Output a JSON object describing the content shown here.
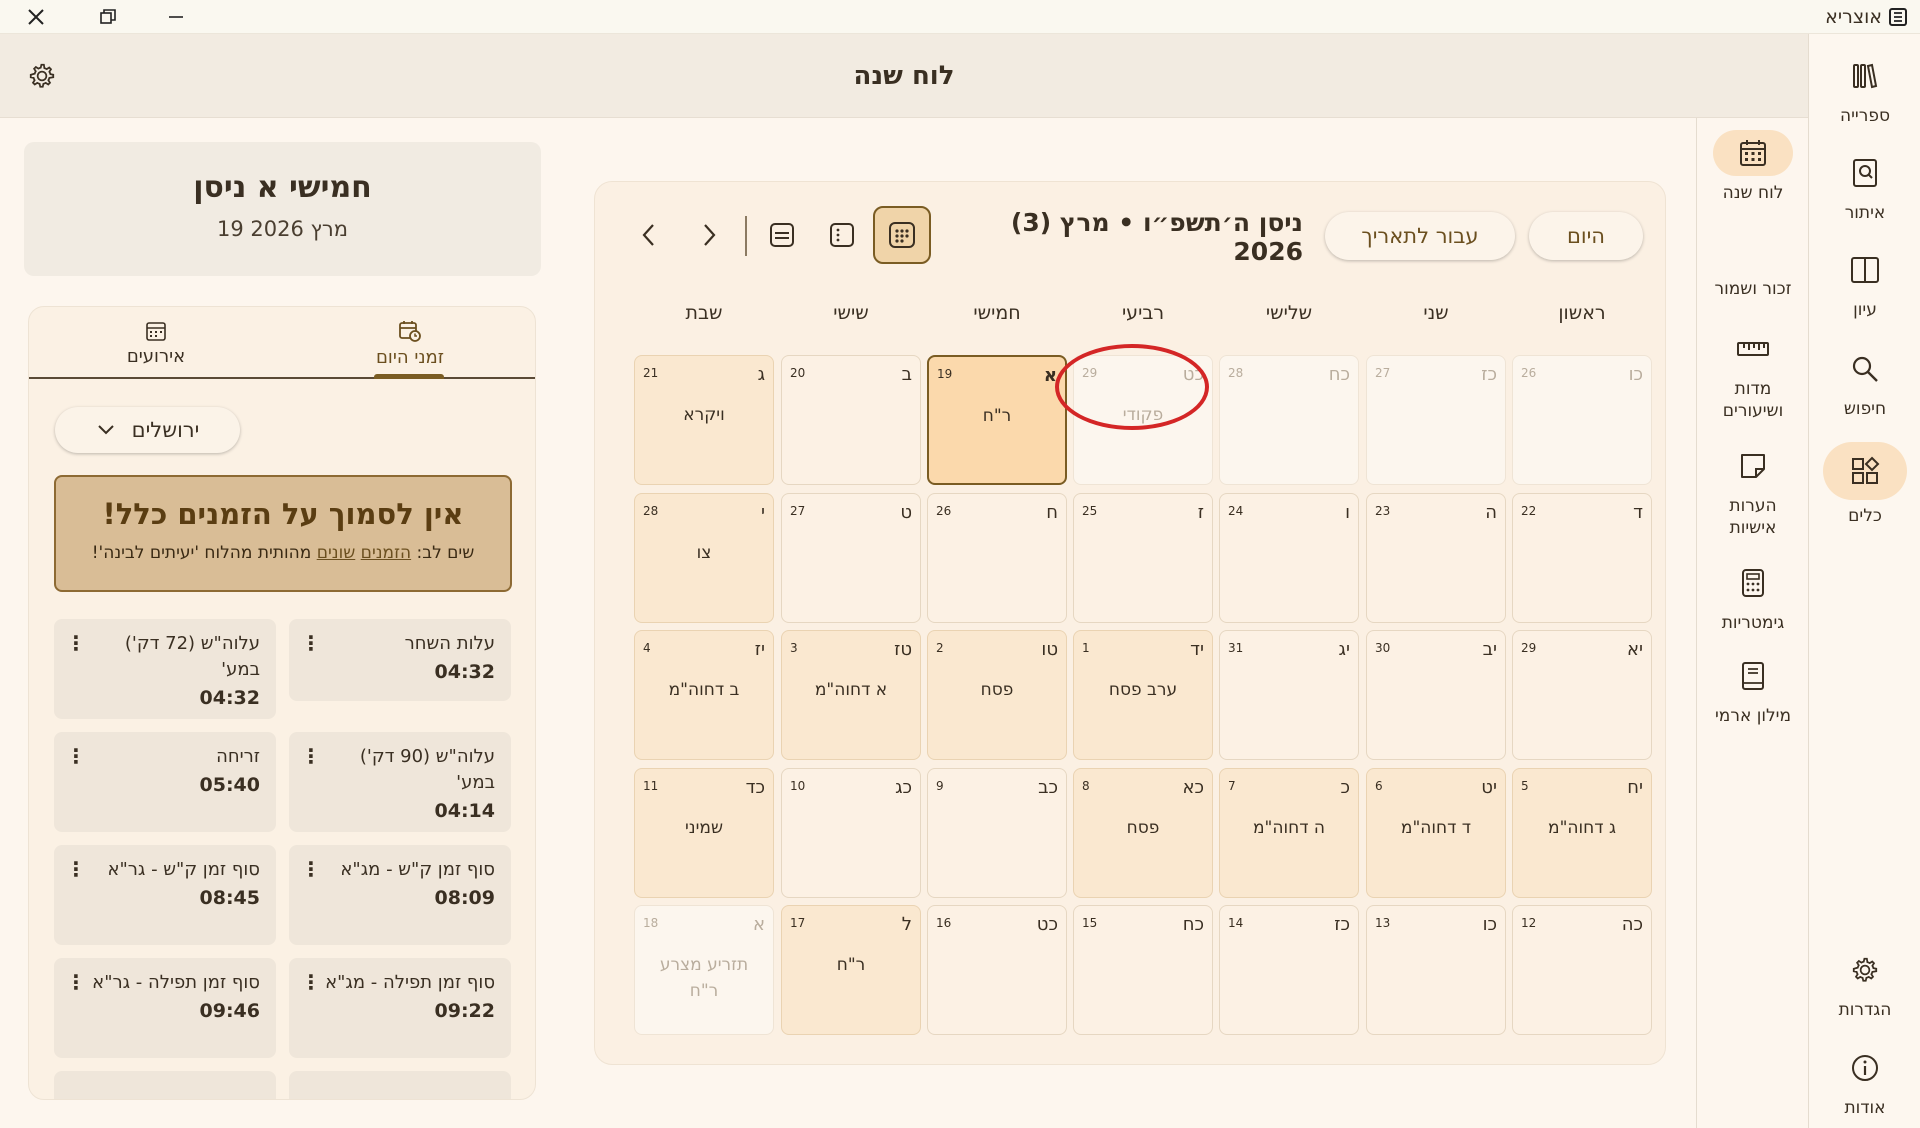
{
  "app": {
    "name": "אוצריא",
    "page_title": "לוח שנה"
  },
  "rail": {
    "items": [
      {
        "label": "ספרייה",
        "icon": "library-icon"
      },
      {
        "label": "איתור",
        "icon": "find-book-icon"
      },
      {
        "label": "עיון",
        "icon": "reading-icon"
      },
      {
        "label": "חיפוש",
        "icon": "search-icon"
      },
      {
        "label": "כלים",
        "icon": "tools-icon",
        "active": true
      },
      {
        "label": "הגדרות",
        "icon": "gear-icon"
      },
      {
        "label": "אודות",
        "icon": "info-icon"
      }
    ]
  },
  "tools": {
    "items": [
      {
        "label": "לוח שנה",
        "icon": "calendar-icon",
        "active": true
      },
      {
        "label": "זכור ושמור"
      },
      {
        "label": "מדות ושיעורים",
        "icon": "ruler-icon"
      },
      {
        "label": "הערות אישיות",
        "icon": "note-icon"
      },
      {
        "label": "גימטריות",
        "icon": "calculator-icon"
      },
      {
        "label": "מילון ארמי",
        "icon": "dictionary-icon"
      }
    ]
  },
  "date_card": {
    "hebrew": "חמישי א ניסן",
    "gregorian": "19 מרץ 2026"
  },
  "zmanim": {
    "tabs": [
      {
        "label": "זמני היום",
        "active": true
      },
      {
        "label": "אירועים"
      }
    ],
    "location": "ירושלים",
    "warning_title": "אין לסמוך על הזמנים כלל!",
    "warning_pre": "שים לב: ",
    "warning_link1": "הזמנים",
    "warning_space": " ",
    "warning_link2": "שונים",
    "warning_post": " מהותית מהלוח 'יעיתים לבינה'!",
    "items": [
      {
        "label": "עלות השחר",
        "time": "04:32"
      },
      {
        "label": "עלוה\"ש (72 דק') במע'",
        "time": "04:32"
      },
      {
        "label": "עלוה\"ש (90 דק') במע'",
        "time": "04:14"
      },
      {
        "label": "זריחה",
        "time": "05:40"
      },
      {
        "label": "סוף זמן ק\"ש - מג\"א",
        "time": "08:09"
      },
      {
        "label": "סוף זמן ק\"ש - גר\"א",
        "time": "08:45"
      },
      {
        "label": "סוף זמן תפילה - מג\"א",
        "time": "09:22"
      },
      {
        "label": "סוף זמן תפילה - גר\"א",
        "time": "09:46"
      }
    ],
    "menu_glyph": "⋮"
  },
  "calendar": {
    "title": "ניסן ה׳תשפ״ו • מרץ (3) 2026",
    "today_label": "היום",
    "goto_label": "עבור לתאריך",
    "day_names": [
      "ראשון",
      "שני",
      "שלישי",
      "רביעי",
      "חמישי",
      "שישי",
      "שבת"
    ],
    "weeks": [
      [
        {
          "h": "כו",
          "g": "26",
          "e": "",
          "type": "other"
        },
        {
          "h": "כז",
          "g": "27",
          "e": "",
          "type": "other"
        },
        {
          "h": "כח",
          "g": "28",
          "e": "",
          "type": "other"
        },
        {
          "h": "כט",
          "g": "29",
          "e": "פקודי",
          "type": "other"
        },
        {
          "h": "א",
          "g": "19",
          "e": "ר\"ח",
          "type": "today"
        },
        {
          "h": "ב",
          "g": "20",
          "e": "",
          "type": "normal"
        },
        {
          "h": "ג",
          "g": "21",
          "e": "ויקרא",
          "type": "holiday"
        }
      ],
      [
        {
          "h": "ד",
          "g": "22",
          "e": "",
          "type": "normal"
        },
        {
          "h": "ה",
          "g": "23",
          "e": "",
          "type": "normal"
        },
        {
          "h": "ו",
          "g": "24",
          "e": "",
          "type": "normal"
        },
        {
          "h": "ז",
          "g": "25",
          "e": "",
          "type": "normal"
        },
        {
          "h": "ח",
          "g": "26",
          "e": "",
          "type": "normal"
        },
        {
          "h": "ט",
          "g": "27",
          "e": "",
          "type": "normal"
        },
        {
          "h": "י",
          "g": "28",
          "e": "צו",
          "type": "holiday"
        }
      ],
      [
        {
          "h": "יא",
          "g": "29",
          "e": "",
          "type": "normal"
        },
        {
          "h": "יב",
          "g": "30",
          "e": "",
          "type": "normal"
        },
        {
          "h": "יג",
          "g": "31",
          "e": "",
          "type": "normal"
        },
        {
          "h": "יד",
          "g": "1",
          "e": "ערב פסח",
          "type": "holiday"
        },
        {
          "h": "טו",
          "g": "2",
          "e": "פסח",
          "type": "holiday"
        },
        {
          "h": "טז",
          "g": "3",
          "e": "א דחוה\"מ",
          "type": "holiday"
        },
        {
          "h": "יז",
          "g": "4",
          "e": "ב דחוה\"מ",
          "type": "holiday"
        }
      ],
      [
        {
          "h": "יח",
          "g": "5",
          "e": "ג דחוה\"מ",
          "type": "holiday"
        },
        {
          "h": "יט",
          "g": "6",
          "e": "ד דחוה\"מ",
          "type": "holiday"
        },
        {
          "h": "כ",
          "g": "7",
          "e": "ה דחוה\"מ",
          "type": "holiday"
        },
        {
          "h": "כא",
          "g": "8",
          "e": "פסח",
          "type": "holiday"
        },
        {
          "h": "כב",
          "g": "9",
          "e": "",
          "type": "normal"
        },
        {
          "h": "כג",
          "g": "10",
          "e": "",
          "type": "normal"
        },
        {
          "h": "כד",
          "g": "11",
          "e": "שמיני",
          "type": "holiday"
        }
      ],
      [
        {
          "h": "כה",
          "g": "12",
          "e": "",
          "type": "normal"
        },
        {
          "h": "כו",
          "g": "13",
          "e": "",
          "type": "normal"
        },
        {
          "h": "כז",
          "g": "14",
          "e": "",
          "type": "normal"
        },
        {
          "h": "כח",
          "g": "15",
          "e": "",
          "type": "normal"
        },
        {
          "h": "כט",
          "g": "16",
          "e": "",
          "type": "normal"
        },
        {
          "h": "ל",
          "g": "17",
          "e": "ר\"ח",
          "type": "holiday"
        },
        {
          "h": "א",
          "g": "18",
          "e": "תזריע מצרע ר\"ח",
          "type": "other"
        }
      ]
    ]
  },
  "colors": {
    "accent": "#7a5c23",
    "today_bg": "#fbd9ac",
    "annotation_circle": "#d42626"
  }
}
